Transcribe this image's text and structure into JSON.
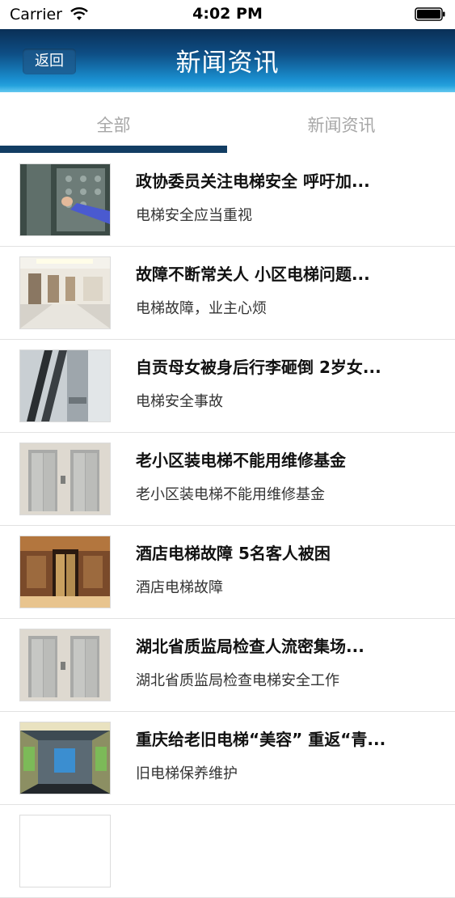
{
  "status_bar": {
    "carrier": "Carrier",
    "time": "4:02 PM"
  },
  "navbar": {
    "back_label": "返回",
    "title": "新闻资讯"
  },
  "tabs": [
    {
      "label": "全部",
      "selected": true
    },
    {
      "label": "新闻资讯",
      "selected": false
    }
  ],
  "colors": {
    "tab_indicator": "#123d63",
    "nav_gradient_top": "#0a2f56",
    "nav_gradient_bottom": "#2fb5ea"
  },
  "news": [
    {
      "title": "政协委员关注电梯安全 呼吁加...",
      "subtitle": "电梯安全应当重视",
      "thumb_icon": "elevator-button-photo"
    },
    {
      "title": "故障不断常关人 小区电梯问题...",
      "subtitle": "电梯故障，业主心烦",
      "thumb_icon": "elevator-lobby-photo"
    },
    {
      "title": "自贡母女被身后行李砸倒 2岁女...",
      "subtitle": "电梯安全事故",
      "thumb_icon": "escalator-photo"
    },
    {
      "title": "老小区装电梯不能用维修基金",
      "subtitle": "老小区装电梯不能用维修基金",
      "thumb_icon": "elevator-doors-photo"
    },
    {
      "title": "酒店电梯故障 5名客人被困",
      "subtitle": "酒店电梯故障",
      "thumb_icon": "hotel-elevator-photo"
    },
    {
      "title": "湖北省质监局检查人流密集场...",
      "subtitle": "湖北省质监局检查电梯安全工作",
      "thumb_icon": "elevator-doors-photo"
    },
    {
      "title": "重庆给老旧电梯“美容” 重返“青...",
      "subtitle": "旧电梯保养维护",
      "thumb_icon": "elevator-cabin-photo"
    }
  ]
}
